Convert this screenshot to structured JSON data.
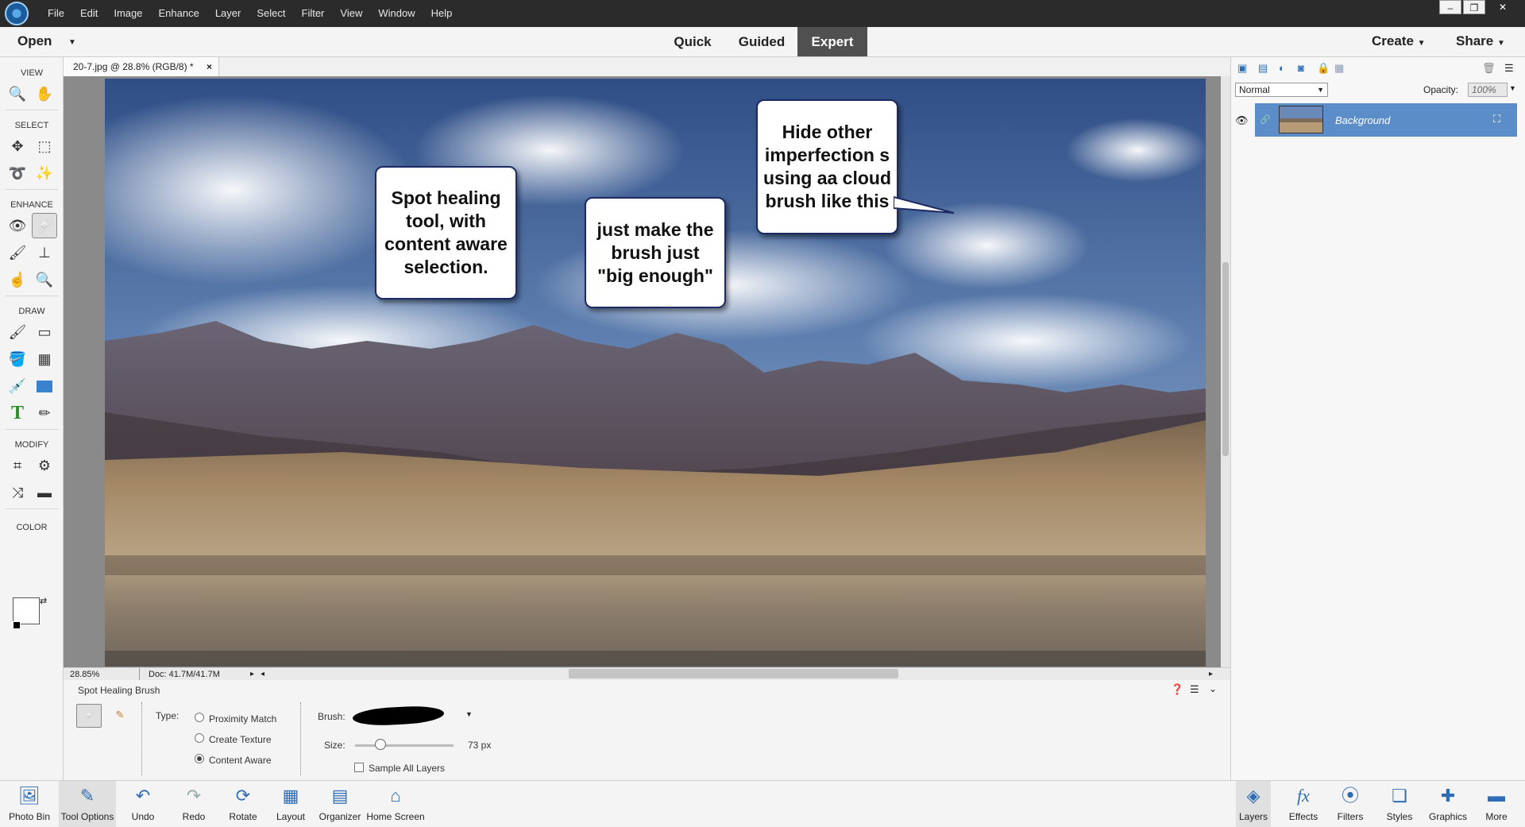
{
  "menu": [
    "File",
    "Edit",
    "Image",
    "Enhance",
    "Layer",
    "Select",
    "Filter",
    "View",
    "Window",
    "Help"
  ],
  "window_controls": [
    "–",
    "❐",
    "✕"
  ],
  "modebar": {
    "open": "Open",
    "tabs": [
      "Quick",
      "Guided",
      "Expert"
    ],
    "active_tab": "Expert",
    "create": "Create",
    "share": "Share"
  },
  "toolbox": {
    "sections": [
      "VIEW",
      "SELECT",
      "ENHANCE",
      "DRAW",
      "MODIFY",
      "COLOR"
    ]
  },
  "document": {
    "tab_title": "20-7.jpg @ 28.8% (RGB/8) *",
    "close": "×",
    "zoom": "28.85%",
    "doc_size": "Doc: 41.7M/41.7M"
  },
  "callouts": [
    "Spot healing tool, with content aware selection.",
    "just make the brush just \"big enough\"",
    "Hide other imperfection s using aa cloud brush like this"
  ],
  "tool_options": {
    "title": "Spot Healing Brush",
    "type_label": "Type:",
    "types": [
      "Proximity Match",
      "Create Texture",
      "Content Aware"
    ],
    "selected_type": "Content Aware",
    "brush_label": "Brush:",
    "size_label": "Size:",
    "size_value": "73 px",
    "size_fraction": 0.26,
    "sample_all_layers": "Sample All Layers"
  },
  "layers_panel": {
    "blend_mode": "Normal",
    "opacity_label": "Opacity:",
    "opacity_value": "100%",
    "layer_name": "Background"
  },
  "dock_left": [
    "Photo Bin",
    "Tool Options",
    "Undo",
    "Redo",
    "Rotate",
    "Layout",
    "Organizer",
    "Home Screen"
  ],
  "dock_right": [
    "Layers",
    "Effects",
    "Filters",
    "Styles",
    "Graphics",
    "More"
  ],
  "colors": {
    "accent": "#5b8dc9",
    "callout_border": "#1c2a63",
    "titlebar": "#2b2b2b"
  }
}
